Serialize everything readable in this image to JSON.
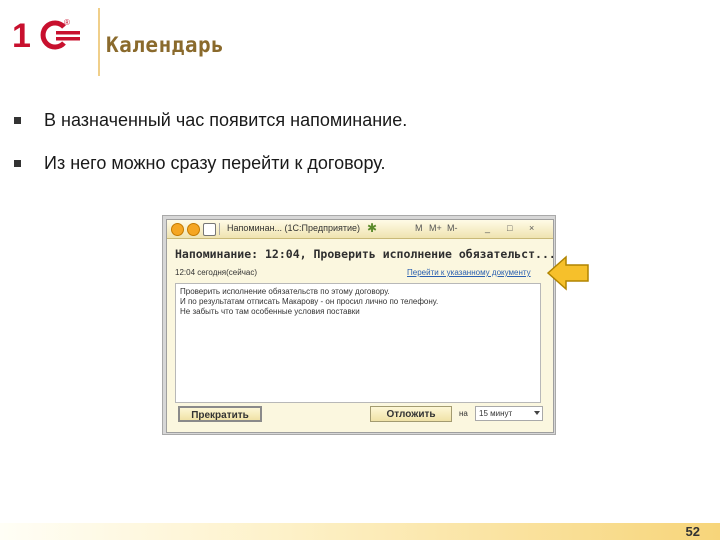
{
  "header": {
    "logo_text": "1C",
    "logo_reg": "®",
    "title": "Календарь"
  },
  "bullets": [
    "В назначенный час появится напоминание.",
    "Из него можно сразу перейти к договору."
  ],
  "window": {
    "titlebar_title": "Напоминан... (1С:Предприятие)",
    "titlebar_buttons": [
      "M",
      "M+",
      "M-",
      "_",
      "□",
      "×"
    ],
    "heading": "Напоминание: 12:04, Проверить исполнение обязательст...",
    "time_text": "12:04 сегодня(сейчас)",
    "link_text": "Перейти к указанному документу",
    "body_lines": [
      "Проверить исполнение обязательств по этому договору.",
      "И по результатам отписать Макарову - он просил лично по телефону.",
      "Не забыть что там особенные условия поставки"
    ],
    "stop_button": "Прекратить",
    "postpone_button": "Отложить",
    "on_label": "на",
    "interval_value": "15 минут"
  },
  "colors": {
    "title": "#8a6a2c",
    "logo_red": "#c8102e",
    "pointer_fill": "#f6c02b",
    "link": "#2a5fb0"
  },
  "icons": {
    "pointer": "arrow-left-icon",
    "bullet": "square-bullet-icon"
  },
  "footer": {
    "page_number": "52"
  }
}
